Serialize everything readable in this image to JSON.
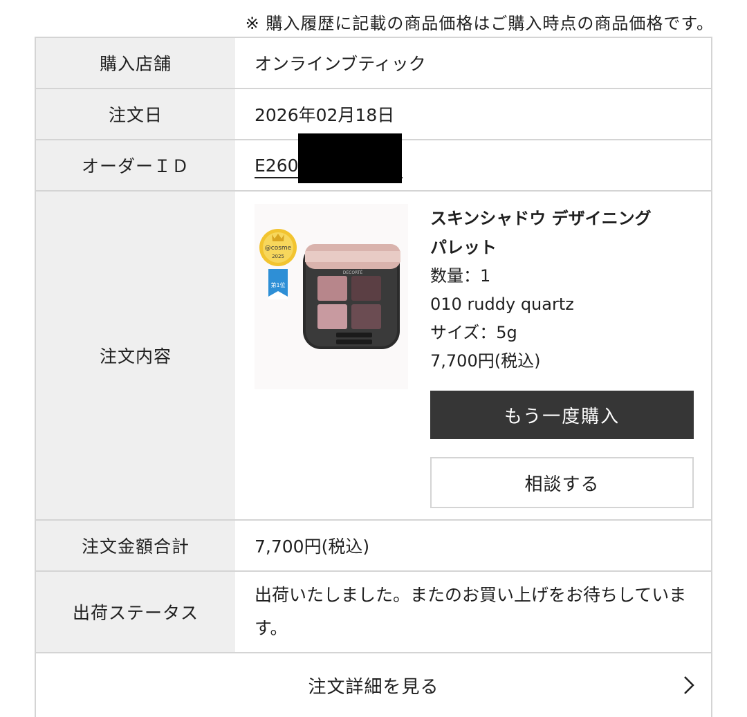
{
  "note": "※ 購入履歴に記載の商品価格はご購入時点の商品価格です。",
  "rows": {
    "store": {
      "label": "購入店舗",
      "value": "オンラインブティック"
    },
    "date": {
      "label": "注文日",
      "value": "2026年02月18日"
    },
    "order_id": {
      "label": "オーダーＩＤ",
      "value": "E260"
    },
    "items": {
      "label": "注文内容",
      "product": {
        "name_line1": "スキンシャドウ デザイニング",
        "name_line2": "パレット",
        "quantity": "数量：1",
        "shade": "010 ruddy quartz",
        "size": "サイズ：5g",
        "price": "7,700円(税込)",
        "badge_text": "@cosme",
        "badge_year": "2025",
        "badge_rank": "第1位",
        "brand": "DECORTÉ"
      },
      "buy_again_label": "もう一度購入",
      "consult_label": "相談する"
    },
    "total": {
      "label": "注文金額合計",
      "value": "7,700円(税込)"
    },
    "status": {
      "label": "出荷ステータス",
      "value": "出荷いたしました。またのお買い上げをお待ちしています。"
    }
  },
  "details_link": "注文詳細を見る",
  "colors": {
    "header_bg": "#efefef",
    "border": "#d4d4d4",
    "button_dark": "#363636"
  }
}
